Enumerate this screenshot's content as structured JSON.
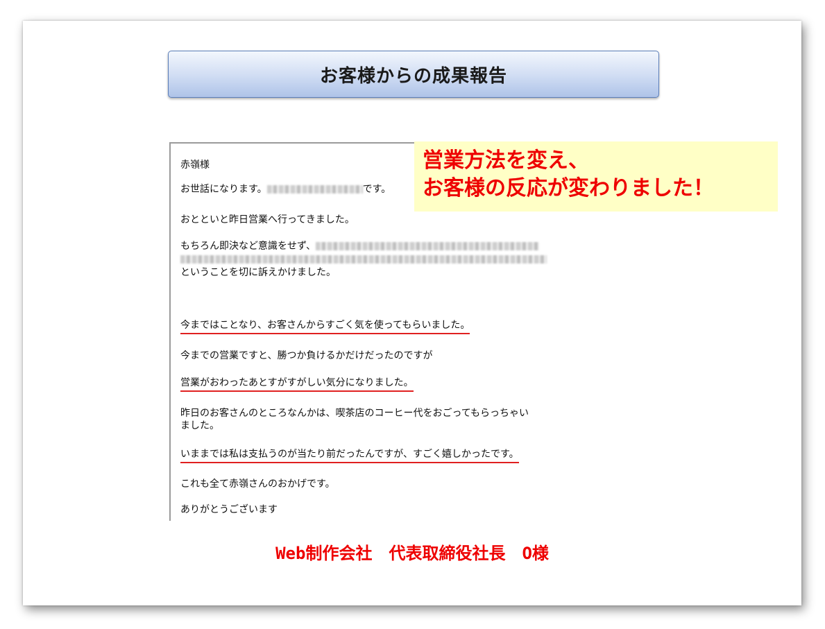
{
  "title": "お客様からの成果報告",
  "email": {
    "greeting": "赤嶺様",
    "line1": "お世話になります。",
    "line1_end": "です。",
    "line2": "おとといと昨日営業へ行ってきました。",
    "line3": "もちろん即決など意識をせず、",
    "line3_end": "ということを切に訴えかけました。",
    "highlight1": "今まではことなり、お客さんからすごく気を使ってもらいました。",
    "line4": "今までの営業ですと、勝つか負けるかだけだったのですが",
    "highlight2": "営業がおわったあとすがすがしい気分になりました。",
    "line5a": "昨日のお客さんのところなんかは、喫茶店のコーヒー代をおごってもらっちゃい",
    "line5b": "ました。",
    "highlight3": "いままでは私は支払うのが当たり前だったんですが、すごく嬉しかったです。",
    "line6": "これも全て赤嶺さんのおかげです。",
    "line7": "ありがとうございます"
  },
  "callout": {
    "line1": "営業方法を変え、",
    "line2": "お客様の反応が変わりました！"
  },
  "signature": "Web制作会社　代表取締役社長　O様",
  "colors": {
    "accent_red": "#ee0000",
    "underline_red": "#e02020",
    "callout_bg": "#ffffc6",
    "title_gradient_bottom": "#aec3e8"
  }
}
